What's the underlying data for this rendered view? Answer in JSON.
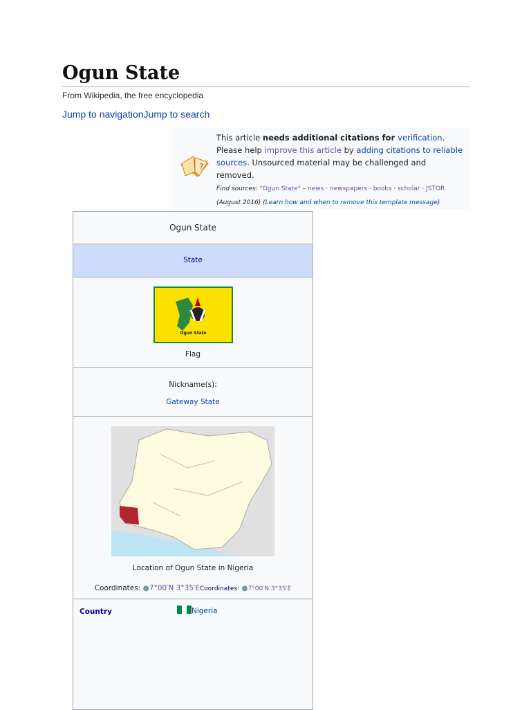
{
  "title": "Ogun State",
  "tagline": "From Wikipedia, the free encyclopedia",
  "jump_nav": "Jump to navigation",
  "jump_search": "Jump to search",
  "notice": {
    "t1": "This article ",
    "t2": "needs additional citations for ",
    "t3": "verification",
    "t4": ". Please help ",
    "t5": "improve this article",
    "t6": " by ",
    "t7": "adding citations to reliable sources",
    "t8": ". Unsourced material may be challenged and removed.",
    "find": "Find sources:",
    "q": "\"Ogun State\"",
    "dash": " – ",
    "news": "news",
    "newspapers": "newspapers",
    "books": "books",
    "scholar": "scholar",
    "jstor": "JSTOR",
    "sep": " · ",
    "date": "(August 2016)",
    "learn": "Learn how and when to remove this template message",
    "open": " (",
    "close": ")"
  },
  "infobox": {
    "title": "Ogun State",
    "type": "State",
    "flag_text": "Ogun State",
    "flag_caption": "Flag",
    "nickname_label": "Nickname(s):",
    "nickname": "Gateway State",
    "map_caption": "Location of Ogun State in Nigeria",
    "coord_label": "Coordinates:",
    "coord": "7°00′N 3°35′E",
    "coord_label2": "Coordinates:",
    "coord2": "7°00′N 3°35′E",
    "country_label": "Country",
    "country": "Nigeria"
  }
}
